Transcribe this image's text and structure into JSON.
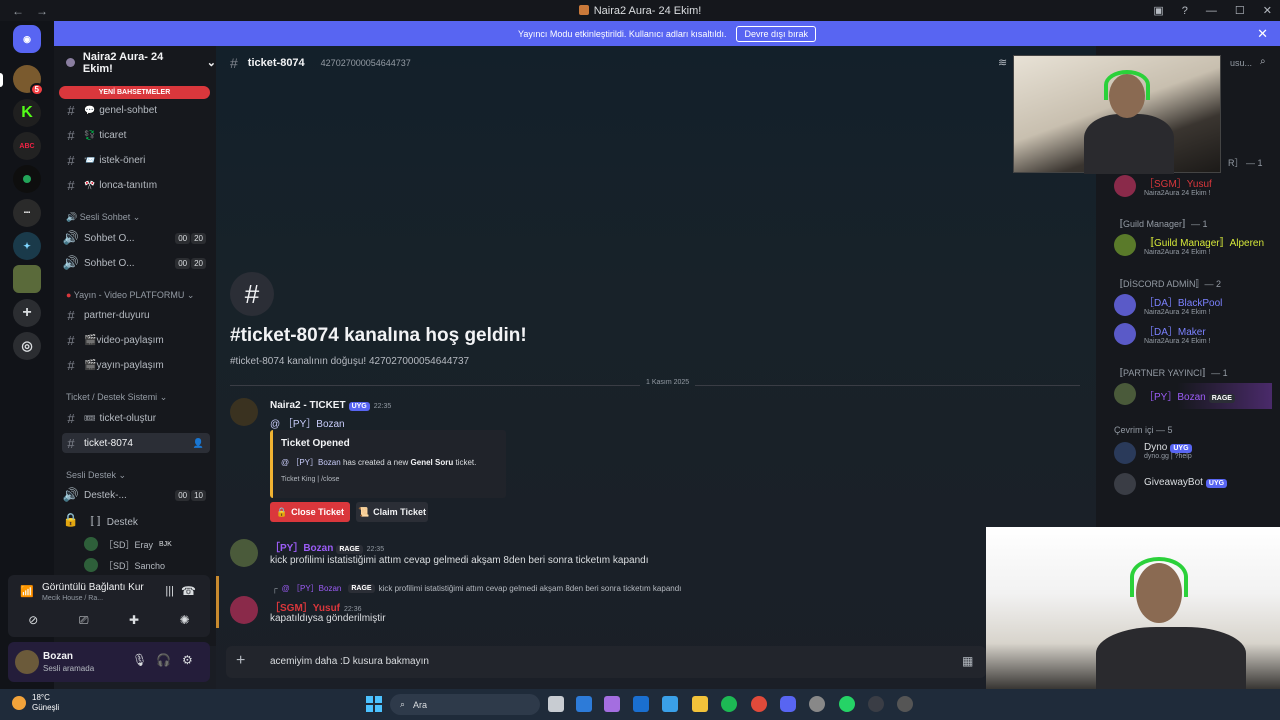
{
  "titlebar": {
    "title": "Naira2 Aura- 24 Ekim!",
    "back": "←",
    "forward": "→"
  },
  "banner": {
    "text": "Yayıncı Modu etkinleştirildi. Kullanıcı adları kısaltıldı.",
    "button": "Devre dışı bırak"
  },
  "server": {
    "name": "Naira2 Aura- 24 Ekim!",
    "new_mentions": "YENİ BAHSETMELER"
  },
  "channels": {
    "text": [
      {
        "emoji": "💬",
        "name": "genel-sohbet"
      },
      {
        "emoji": "💱",
        "name": "ticaret"
      },
      {
        "emoji": "📨",
        "name": "istek-öneri"
      },
      {
        "emoji": "🎌",
        "name": "lonca-tanıtım"
      }
    ],
    "voice_category": "Sesli Sohbet",
    "voice": [
      {
        "name": "Sohbet O...",
        "a": "00",
        "b": "20"
      },
      {
        "name": "Sohbet O...",
        "a": "00",
        "b": "20"
      }
    ],
    "stream_category": "Yayın - Video PLATFORMU",
    "stream": [
      "partner-duyuru",
      "🎬video-paylaşım",
      "🎬yayın-paylaşım"
    ],
    "ticket_category": "Ticket / Destek Sistemi",
    "ticket": [
      "ticket-oluştur",
      "ticket-8074"
    ],
    "support_category": "Sesli Destek",
    "support": [
      {
        "name": "Destek-...",
        "a": "00",
        "b": "10"
      },
      {
        "name": "〚 〛Destek"
      }
    ],
    "voice_members": [
      {
        "name": "［SD］Eray",
        "tag": "BJK"
      },
      {
        "name": "［SD］Sancho",
        "tag": ""
      }
    ]
  },
  "voice_panel": {
    "title": "Görüntülü Bağlantı Kur",
    "sub": "Mecik House / Ra..."
  },
  "user": {
    "name": "Bozan",
    "status": "Sesli aramada"
  },
  "channel_header": {
    "name": "ticket-8074",
    "id": "427027000054644737"
  },
  "welcome": {
    "title": "#ticket-8074 kanalına hoş geldin!",
    "sub": "#ticket-8074 kanalının doğuşu! 427027000054644737"
  },
  "date_divider": "1 Kasım 2025",
  "messages": [
    {
      "author": "Naira2 - TICKET",
      "app_tag": "UYG",
      "time": "22:35",
      "text": "@ ［PY］Bozan",
      "embed": {
        "title": "Ticket Opened",
        "mention": "@ ［PY］Bozan",
        "desc_pre": "has created a new",
        "desc_bold": "Genel Soru",
        "desc_post": "ticket.",
        "footer": "Ticket King | /close"
      },
      "buttons": {
        "close": "Close Ticket",
        "claim": "Claim Ticket"
      }
    },
    {
      "author": "［PY］Bozan",
      "tag": "RAGE",
      "time": "22:35",
      "text": "kick profilimi istatistiğimi attım cevap gelmedi akşam 8den beri sonra ticketım kapandı"
    },
    {
      "reply_author": "@ ［PY］Bozan",
      "reply_tag": "RAGE",
      "reply_text": "kick profilimi istatistiğimi attım cevap gelmedi akşam 8den beri sonra ticketım kapandı",
      "author": "［SGM］Yusuf",
      "time": "22:36",
      "text": "kapatıldıysa gönderilmiştir"
    }
  ],
  "composer": {
    "value": "acemiyim daha :D kusura bakmayın"
  },
  "members": {
    "top_partial": "R］ — 1",
    "top_member": {
      "name": "［SGM］Yusuf",
      "status": "Naira2Aura 24 Ekim !"
    },
    "gm_category": "〚Guild Manager〛— 1",
    "gm_member": {
      "name": "〚Guild Manager〛Alperen",
      "status": "Naira2Aura 24 Ekim !"
    },
    "admin_category": "〚DİSCORD ADMİN〛— 2",
    "admins": [
      {
        "name": "［DA］BlackPool",
        "status": "Naira2Aura 24 Ekim !"
      },
      {
        "name": "［DA］Maker",
        "status": "Naira2Aura 24 Ekim !"
      }
    ],
    "partner_category": "〚PARTNER YAYINCI〛— 1",
    "partner": {
      "name": "［PY］Bozan",
      "tag": "RAGE"
    },
    "online_category": "Çevrim içi — 5",
    "bots": [
      {
        "name": "Dyno",
        "tag": "UYG",
        "status": "dyno.gg | ?help"
      },
      {
        "name": "GiveawayBot",
        "tag": "UYG",
        "status": ""
      }
    ],
    "search_partial": "usu..."
  },
  "taskbar": {
    "temp": "18°C",
    "weather": "Güneşli",
    "search": "Ara"
  },
  "colors": {
    "accent": "#5865f2",
    "danger": "#da373c",
    "online": "#23a55a",
    "streamer": "#9b5cf6"
  }
}
